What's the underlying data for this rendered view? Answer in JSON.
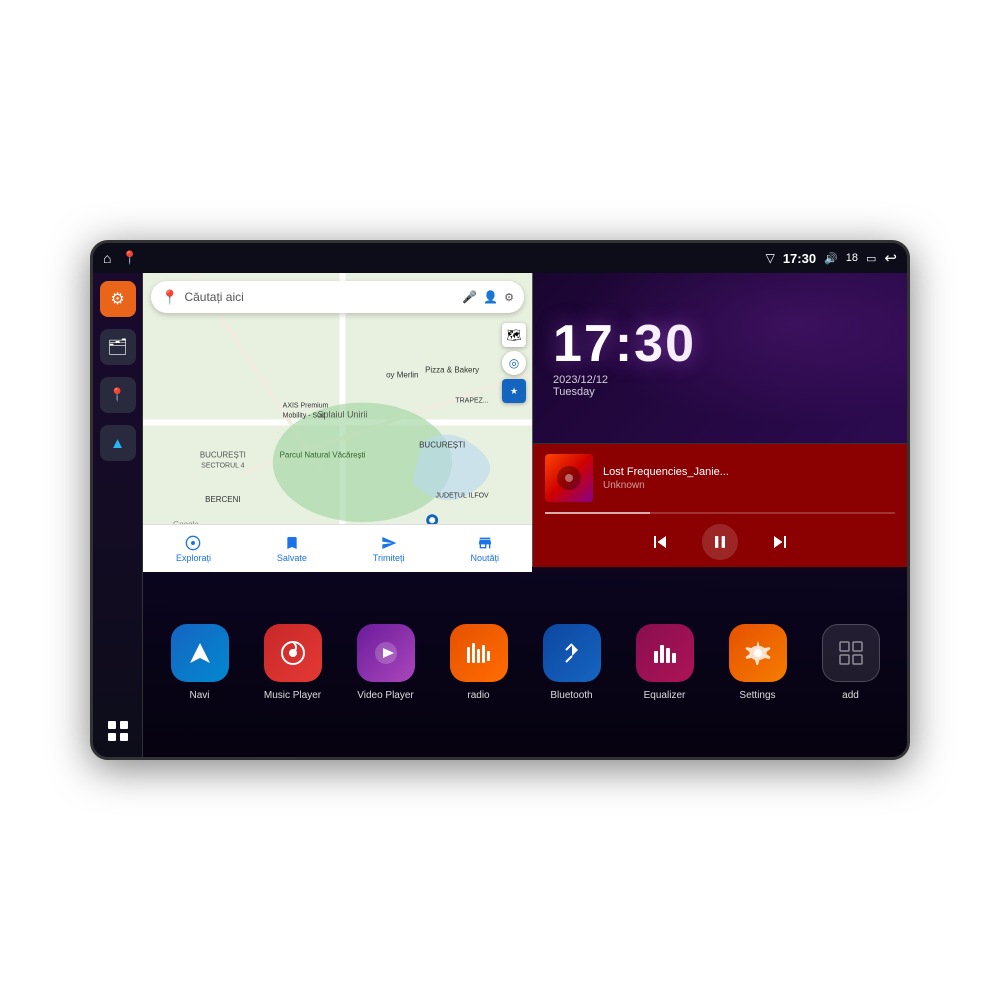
{
  "device": {
    "statusBar": {
      "time": "17:30",
      "signal": "18",
      "battery": "▭",
      "back": "↩"
    },
    "clock": {
      "time": "17:30",
      "date": "2023/12/12",
      "day": "Tuesday"
    },
    "music": {
      "title": "Lost Frequencies_Janie...",
      "artist": "Unknown"
    },
    "map": {
      "searchPlaceholder": "Căutați aici",
      "bottomItems": [
        "Explorați",
        "Salvate",
        "Trimiteți",
        "Noutăți"
      ]
    },
    "apps": [
      {
        "id": "navi",
        "label": "Navi",
        "iconClass": "icon-navi"
      },
      {
        "id": "music-player",
        "label": "Music Player",
        "iconClass": "icon-music"
      },
      {
        "id": "video-player",
        "label": "Video Player",
        "iconClass": "icon-video"
      },
      {
        "id": "radio",
        "label": "radio",
        "iconClass": "icon-radio"
      },
      {
        "id": "bluetooth",
        "label": "Bluetooth",
        "iconClass": "icon-bluetooth"
      },
      {
        "id": "equalizer",
        "label": "Equalizer",
        "iconClass": "icon-equalizer"
      },
      {
        "id": "settings",
        "label": "Settings",
        "iconClass": "icon-settings"
      },
      {
        "id": "add",
        "label": "add",
        "iconClass": "icon-add"
      }
    ],
    "sidebar": {
      "items": [
        {
          "id": "settings",
          "icon": "⚙",
          "iconClass": "orange"
        },
        {
          "id": "file",
          "icon": "🗂",
          "iconClass": "dark"
        },
        {
          "id": "map",
          "icon": "📍",
          "iconClass": "dark"
        },
        {
          "id": "nav",
          "icon": "▲",
          "iconClass": "dark"
        }
      ]
    }
  }
}
